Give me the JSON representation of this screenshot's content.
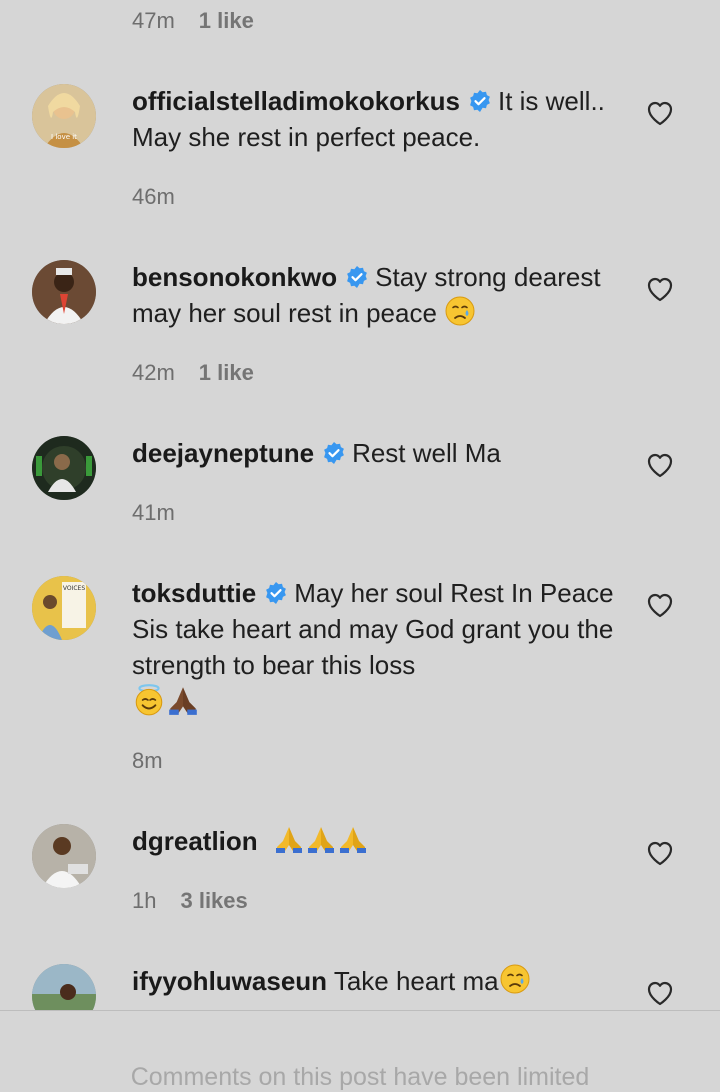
{
  "top_meta": {
    "time": "47m",
    "likes": "1 like"
  },
  "comments": [
    {
      "username": "officialstelladimokokorkus",
      "verified": true,
      "text": "It is well.. May she rest in perfect peace.",
      "time": "46m",
      "likes": "",
      "avatar_color": "#c9a86a"
    },
    {
      "username": "bensonokonkwo",
      "verified": true,
      "text": "Stay strong dearest may her soul rest in peace",
      "emoji": "crying-face",
      "time": "42m",
      "likes": "1 like",
      "avatar_color": "#7a4a2c"
    },
    {
      "username": "deejayneptune",
      "verified": true,
      "text": "Rest well Ma",
      "time": "41m",
      "likes": "",
      "avatar_color": "#2a3b2a"
    },
    {
      "username": "toksduttie",
      "verified": true,
      "text": "May her soul Rest In Peace Sis take heart and may God grant you the strength to bear this loss",
      "emoji": "halo-smile + praying-hands",
      "time": "8m",
      "likes": "",
      "avatar_color": "#d9b84a"
    },
    {
      "username": "dgreatlion",
      "verified": false,
      "text": "",
      "emoji": "praying-hands x3",
      "time": "1h",
      "likes": "3 likes",
      "avatar_color": "#9a9a9a"
    },
    {
      "username": "ifyyohluwaseun",
      "verified": false,
      "text": "Take heart ma",
      "emoji": "crying-face",
      "time": "",
      "likes": "",
      "avatar_color": "#5e7a8a"
    }
  ],
  "footer": {
    "notice": "Comments on this post have been limited"
  },
  "colors": {
    "background": "#d6d6d6",
    "verified_blue": "#3897f0",
    "meta_gray": "#6e6e6e"
  }
}
